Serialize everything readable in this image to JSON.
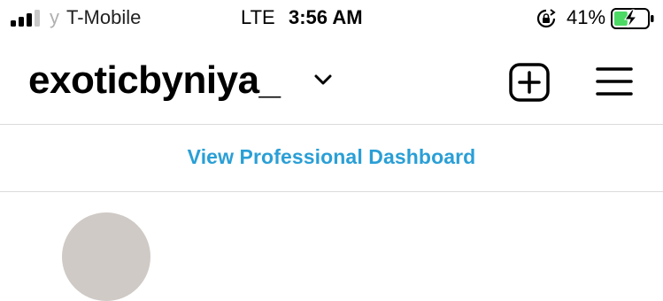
{
  "status_bar": {
    "carrier_prefix": "y",
    "carrier": "T-Mobile",
    "network": "LTE",
    "time": "3:56 AM",
    "battery_percent": "41%",
    "battery_level": 0.41,
    "charging": true
  },
  "header": {
    "username": "exoticbyniya_",
    "create_icon": "plus-square-icon",
    "menu_icon": "hamburger-menu-icon"
  },
  "dashboard": {
    "link_label": "View Professional Dashboard",
    "link_color": "#2a9fd6"
  },
  "colors": {
    "battery_fill": "#4cd964",
    "divider": "#dbdbdb"
  }
}
